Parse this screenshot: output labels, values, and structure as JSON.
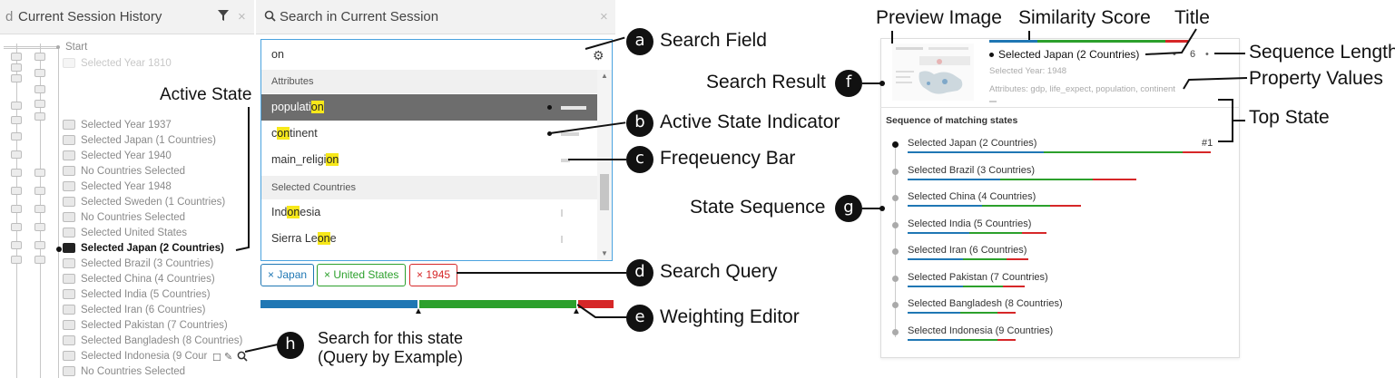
{
  "history": {
    "title": "Current Session History",
    "title_prefix": "d",
    "filter_icon": "filter-icon",
    "close_icon": "close-icon",
    "items": [
      {
        "label": "Start",
        "state": "start"
      },
      {
        "label": "Selected Year 1810",
        "state": "faded"
      },
      {
        "label": "Selected Year 1937",
        "state": "normal"
      },
      {
        "label": "Selected Japan (1 Countries)",
        "state": "normal"
      },
      {
        "label": "Selected Year 1940",
        "state": "normal"
      },
      {
        "label": "No Countries Selected",
        "state": "normal"
      },
      {
        "label": "Selected Year 1948",
        "state": "normal"
      },
      {
        "label": "Selected Sweden (1 Countries)",
        "state": "normal"
      },
      {
        "label": "No Countries Selected",
        "state": "normal"
      },
      {
        "label": "Selected United States",
        "state": "normal"
      },
      {
        "label": "Selected Japan (2 Countries)",
        "state": "active"
      },
      {
        "label": "Selected Brazil (3 Countries)",
        "state": "normal"
      },
      {
        "label": "Selected China (4 Countries)",
        "state": "normal"
      },
      {
        "label": "Selected India (5 Countries)",
        "state": "normal"
      },
      {
        "label": "Selected Iran (6 Countries)",
        "state": "normal"
      },
      {
        "label": "Selected Pakistan (7 Countries)",
        "state": "normal"
      },
      {
        "label": "Selected Bangladesh (8 Countries)",
        "state": "normal"
      },
      {
        "label": "Selected Indonesia (9 Cour",
        "state": "normal"
      },
      {
        "label": "No Countries Selected",
        "state": "normal"
      }
    ]
  },
  "search": {
    "title": "Search in Current Session",
    "search_icon": "search-icon",
    "close_icon": "close-icon",
    "input_value": "on",
    "settings_icon": "gear-icon",
    "groups": [
      {
        "label": "Attributes",
        "options": [
          {
            "pre": "populati",
            "match": "on",
            "post": "",
            "selected": true,
            "freq": 1.0
          },
          {
            "pre": "c",
            "match": "on",
            "post": "tinent",
            "selected": false,
            "freq": 0.7
          },
          {
            "pre": "main_religi",
            "match": "on",
            "post": "",
            "selected": false,
            "freq": 0.35
          }
        ]
      },
      {
        "label": "Selected Countries",
        "options": [
          {
            "pre": "Ind",
            "match": "on",
            "post": "esia",
            "selected": false,
            "freq": 0.05
          },
          {
            "pre": "Sierra Le",
            "match": "on",
            "post": "e",
            "selected": false,
            "freq": 0.05
          }
        ]
      }
    ],
    "chips": [
      {
        "label": "× Japan",
        "color": "#1f77b4"
      },
      {
        "label": "× United States",
        "color": "#2ca02c"
      },
      {
        "label": "× 1945",
        "color": "#d62728"
      }
    ],
    "weights": [
      {
        "color": "#1f77b4",
        "fraction": 0.45
      },
      {
        "color": "#2ca02c",
        "fraction": 0.45
      },
      {
        "color": "#d62728",
        "fraction": 0.1
      }
    ]
  },
  "annotations": {
    "a": {
      "letter": "a",
      "label": "Search Field"
    },
    "b": {
      "letter": "b",
      "label": "Active State Indicator"
    },
    "c": {
      "letter": "c",
      "label": "Freqeuency Bar"
    },
    "d": {
      "letter": "d",
      "label": "Search Query"
    },
    "e": {
      "letter": "e",
      "label": "Weighting Editor"
    },
    "f": {
      "letter": "f",
      "label": "Search Result"
    },
    "g": {
      "letter": "g",
      "label": "State Sequence"
    },
    "h": {
      "letter": "h",
      "label_line1": "Search for this state",
      "label_line2": "(Query by Example)"
    },
    "active_state": "Active State",
    "preview_image": "Preview Image",
    "similarity_score": "Similarity Score",
    "title": "Title",
    "sequence_length": "Sequence Length",
    "property_values": "Property Values",
    "top_state": "Top State"
  },
  "result": {
    "title": "Selected Japan (2 Countries)",
    "sequence_length": "6",
    "subtitle": "Selected Year: 1948",
    "attributes": "Attributes: gdp, life_expect, population, continent",
    "similarity": [
      {
        "color": "#1f77b4",
        "fraction": 0.21
      },
      {
        "color": "#2ca02c",
        "fraction": 0.56
      },
      {
        "color": "#d62728",
        "fraction": 0.1
      }
    ],
    "sequence_heading": "Sequence of matching states",
    "top_rank": "#1",
    "sequence": [
      {
        "label": "Selected Japan (2 Countries)",
        "bars": [
          0.44,
          0.45,
          0.09
        ]
      },
      {
        "label": "Selected Brazil (3 Countries)",
        "bars": [
          0.3,
          0.3,
          0.14
        ]
      },
      {
        "label": "Selected China (4 Countries)",
        "bars": [
          0.24,
          0.22,
          0.1
        ]
      },
      {
        "label": "Selected India (5 Countries)",
        "bars": [
          0.2,
          0.17,
          0.08
        ]
      },
      {
        "label": "Selected Iran (6 Countries)",
        "bars": [
          0.18,
          0.14,
          0.07
        ]
      },
      {
        "label": "Selected Pakistan (7 Countries)",
        "bars": [
          0.18,
          0.13,
          0.07
        ]
      },
      {
        "label": "Selected Bangladesh (8 Countries)",
        "bars": [
          0.17,
          0.12,
          0.06
        ]
      },
      {
        "label": "Selected Indonesia (9 Countries)",
        "bars": [
          0.17,
          0.12,
          0.06
        ]
      }
    ]
  }
}
